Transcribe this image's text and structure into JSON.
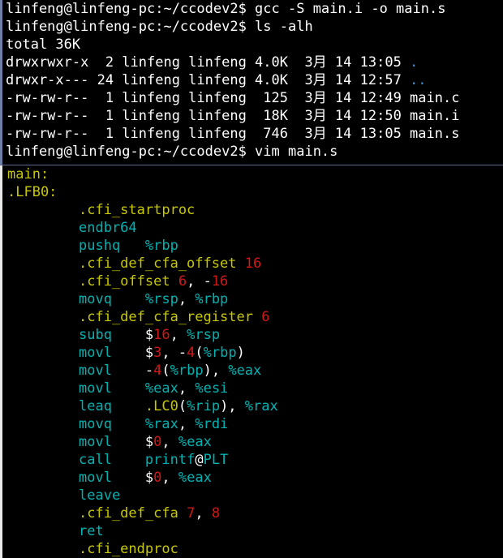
{
  "shell": {
    "lines": [
      {
        "text": "linfeng@linfeng-pc:~/ccodev2$ gcc -S main.i -o main.s"
      },
      {
        "text": "linfeng@linfeng-pc:~/ccodev2$ ls -alh"
      },
      {
        "text": "total 36K"
      },
      {
        "text": "drwxrwxr-x  2 linfeng linfeng 4.0K  3月 14 13:05 ",
        "tail": "."
      },
      {
        "text": "drwxr-x--- 24 linfeng linfeng 4.0K  3月 14 12:57 ",
        "tail": ".."
      },
      {
        "text": "-rw-rw-r--  1 linfeng linfeng  125  3月 14 12:49 main.c"
      },
      {
        "text": "-rw-rw-r--  1 linfeng linfeng  18K  3月 14 12:50 main.i"
      },
      {
        "text": "-rw-rw-r--  1 linfeng linfeng  746  3月 14 13:05 main.s"
      },
      {
        "text": "linfeng@linfeng-pc:~/ccodev2$ vim main.s"
      }
    ]
  },
  "vim": {
    "label_main": "main:",
    "label_lfb0": ".LFB0:",
    "lines": [
      {
        "op": ".cfi_startproc",
        "kind": "dirv",
        "args": []
      },
      {
        "op": "endbr64",
        "kind": "ins",
        "args": []
      },
      {
        "op": "pushq",
        "kind": "ins",
        "args": [
          {
            "t": "%rbp",
            "c": "reg"
          }
        ]
      },
      {
        "op": ".cfi_def_cfa_offset",
        "kind": "dirv",
        "args": [
          {
            "t": "16",
            "c": "num"
          }
        ]
      },
      {
        "op": ".cfi_offset",
        "kind": "dirv",
        "args": [
          {
            "t": "6",
            "c": "num"
          },
          {
            "t": ", -",
            "c": "plain"
          },
          {
            "t": "16",
            "c": "num"
          }
        ]
      },
      {
        "op": "movq",
        "kind": "ins",
        "args": [
          {
            "t": "%rsp",
            "c": "reg"
          },
          {
            "t": ", ",
            "c": "plain"
          },
          {
            "t": "%rbp",
            "c": "reg"
          }
        ]
      },
      {
        "op": ".cfi_def_cfa_register",
        "kind": "dirv",
        "args": [
          {
            "t": "6",
            "c": "num"
          }
        ]
      },
      {
        "op": "subq",
        "kind": "ins",
        "args": [
          {
            "t": "$",
            "c": "plain"
          },
          {
            "t": "16",
            "c": "num"
          },
          {
            "t": ", ",
            "c": "plain"
          },
          {
            "t": "%rsp",
            "c": "reg"
          }
        ]
      },
      {
        "op": "movl",
        "kind": "ins",
        "args": [
          {
            "t": "$",
            "c": "plain"
          },
          {
            "t": "3",
            "c": "num"
          },
          {
            "t": ", -",
            "c": "plain"
          },
          {
            "t": "4",
            "c": "num"
          },
          {
            "t": "(",
            "c": "plain"
          },
          {
            "t": "%rbp",
            "c": "reg"
          },
          {
            "t": ")",
            "c": "plain"
          }
        ]
      },
      {
        "op": "movl",
        "kind": "ins",
        "args": [
          {
            "t": "-",
            "c": "plain"
          },
          {
            "t": "4",
            "c": "num"
          },
          {
            "t": "(",
            "c": "plain"
          },
          {
            "t": "%rbp",
            "c": "reg"
          },
          {
            "t": "), ",
            "c": "plain"
          },
          {
            "t": "%eax",
            "c": "reg"
          }
        ]
      },
      {
        "op": "movl",
        "kind": "ins",
        "args": [
          {
            "t": "%eax",
            "c": "reg"
          },
          {
            "t": ", ",
            "c": "plain"
          },
          {
            "t": "%esi",
            "c": "reg"
          }
        ]
      },
      {
        "op": "leaq",
        "kind": "ins",
        "args": [
          {
            "t": ".LC0",
            "c": "dirv"
          },
          {
            "t": "(",
            "c": "plain"
          },
          {
            "t": "%rip",
            "c": "reg"
          },
          {
            "t": "), ",
            "c": "plain"
          },
          {
            "t": "%rax",
            "c": "reg"
          }
        ]
      },
      {
        "op": "movq",
        "kind": "ins",
        "args": [
          {
            "t": "%rax",
            "c": "reg"
          },
          {
            "t": ", ",
            "c": "plain"
          },
          {
            "t": "%rdi",
            "c": "reg"
          }
        ]
      },
      {
        "op": "movl",
        "kind": "ins",
        "args": [
          {
            "t": "$",
            "c": "plain"
          },
          {
            "t": "0",
            "c": "num"
          },
          {
            "t": ", ",
            "c": "plain"
          },
          {
            "t": "%eax",
            "c": "reg"
          }
        ]
      },
      {
        "op": "call",
        "kind": "ins",
        "args": [
          {
            "t": "printf",
            "c": "sym"
          },
          {
            "t": "@",
            "c": "plain"
          },
          {
            "t": "PLT",
            "c": "sym"
          }
        ]
      },
      {
        "op": "movl",
        "kind": "ins",
        "args": [
          {
            "t": "$",
            "c": "plain"
          },
          {
            "t": "0",
            "c": "num"
          },
          {
            "t": ", ",
            "c": "plain"
          },
          {
            "t": "%eax",
            "c": "reg"
          }
        ]
      },
      {
        "op": "leave",
        "kind": "ins",
        "args": []
      },
      {
        "op": ".cfi_def_cfa",
        "kind": "dirv",
        "args": [
          {
            "t": "7",
            "c": "num"
          },
          {
            "t": ", ",
            "c": "plain"
          },
          {
            "t": "8",
            "c": "num"
          }
        ]
      },
      {
        "op": "ret",
        "kind": "ins",
        "args": []
      },
      {
        "op": ".cfi_endproc",
        "kind": "dirv",
        "args": []
      }
    ]
  },
  "colors": {
    "background": "#000000",
    "text": "#ffffff",
    "directory": "#3b8fd6",
    "label": "#c8c800",
    "instruction": "#00b3b3",
    "number": "#d01818"
  }
}
